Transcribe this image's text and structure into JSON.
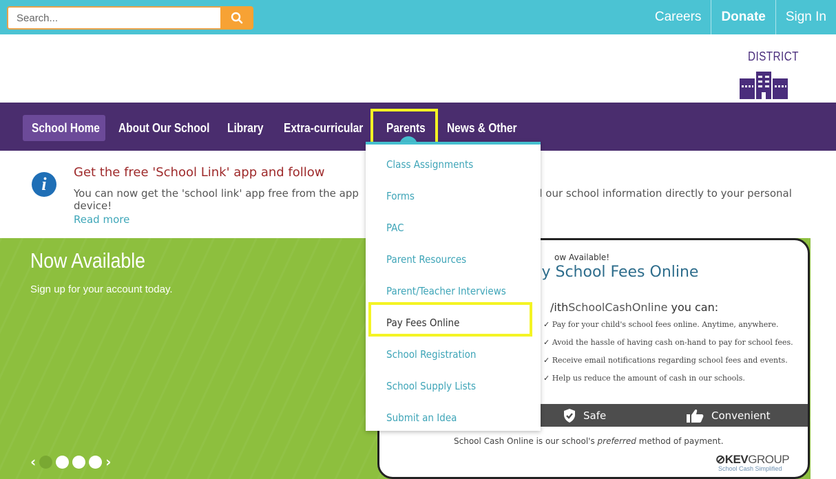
{
  "search": {
    "placeholder": "Search..."
  },
  "top_links": [
    "Careers",
    "Donate",
    "Sign In"
  ],
  "header": {
    "district_label": "DISTRICT"
  },
  "nav": {
    "items": [
      "School Home",
      "About Our School",
      "Library",
      "Extra-curricular",
      "Parents",
      "News & Other"
    ],
    "active": "School Home",
    "highlighted": "Parents"
  },
  "alert": {
    "title": "Get the free 'School Link' app and follow",
    "body_left": "You can now get the 'school link' app free from the app",
    "body_right": "all our school information directly to your personal",
    "body_end": "device!",
    "read_more": "Read more"
  },
  "hero": {
    "title": "Now Available",
    "subtitle": "Sign up for your account today.",
    "prev": "‹",
    "next": "›"
  },
  "ad": {
    "small": "ow Available!",
    "title": "ay School Fees Online",
    "with_prefix": "/ith",
    "with_brand": "SchoolCashOnline",
    "with_suffix": " you can:",
    "bullets": [
      "Pay for your child's school fees online. Anytime, anywhere.",
      "Avoid the hassle of having cash on-hand to pay for school fees.",
      "Receive email notifications regarding school fees and events.",
      "Help us reduce the amount of cash in our schools."
    ],
    "bar_safe": "Safe",
    "bar_convenient": "Convenient",
    "footer_prefix": "School Cash Online is our school's ",
    "footer_em": "preferred",
    "footer_suffix": " method of payment.",
    "kev_bold": "KEV",
    "kev_light": "GROUP",
    "kev_tag": "School Cash Simplified"
  },
  "dropdown": {
    "items": [
      "Class Assignments",
      "Forms",
      "PAC",
      "Parent Resources",
      "Parent/Teacher Interviews",
      "Pay Fees Online",
      "School Registration",
      "School Supply Lists",
      "Submit an Idea"
    ],
    "highlighted": "Pay Fees Online"
  },
  "colors": {
    "topbar": "#4bc3d3",
    "search_button": "#f7a234",
    "nav": "#4a2d6e",
    "hero": "#8dbf3e",
    "link": "#3fa5b8",
    "highlight": "#f4f424"
  }
}
